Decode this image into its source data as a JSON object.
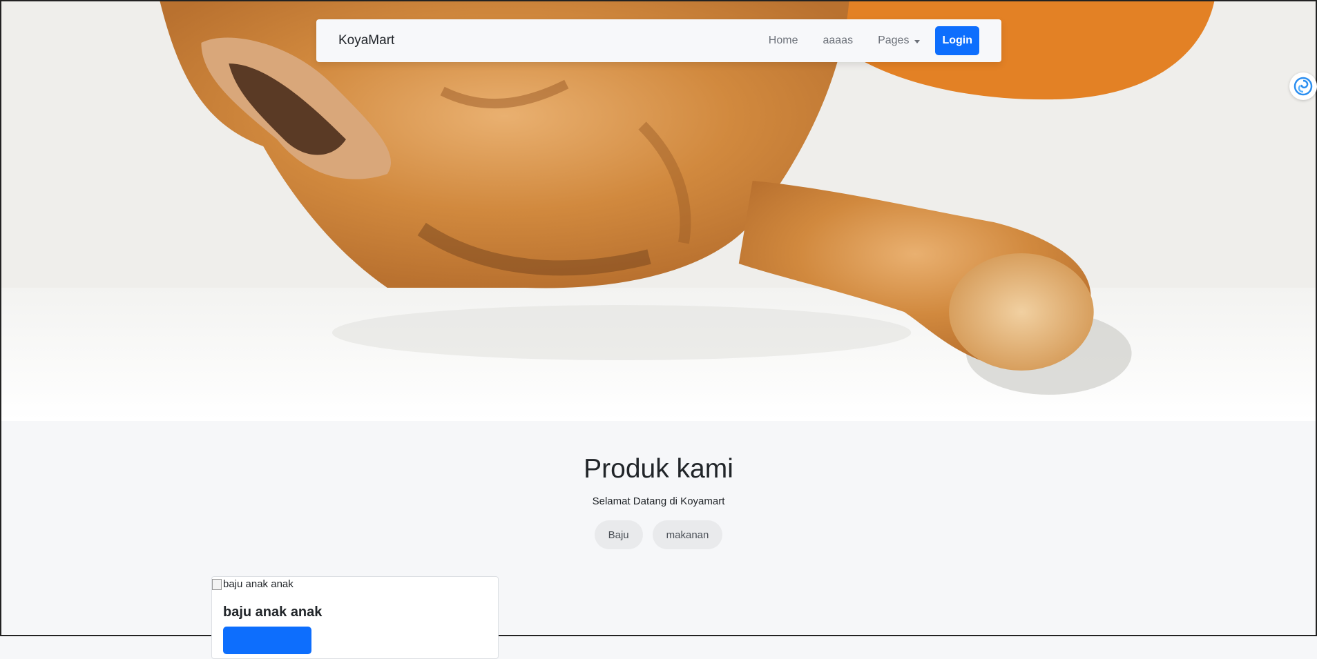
{
  "navbar": {
    "brand": "KoyaMart",
    "links": [
      "Home",
      "aaaas"
    ],
    "dropdown_label": "Pages",
    "login_label": "Login"
  },
  "colors": {
    "primary": "#0d6efd",
    "hero_orange": "#e38125"
  },
  "products": {
    "title": "Produk kami",
    "subtitle": "Selamat Datang di Koyamart",
    "filters": [
      "Baju",
      "makanan"
    ],
    "cards": [
      {
        "image_alt": "baju anak anak",
        "title": "baju anak anak"
      }
    ]
  }
}
